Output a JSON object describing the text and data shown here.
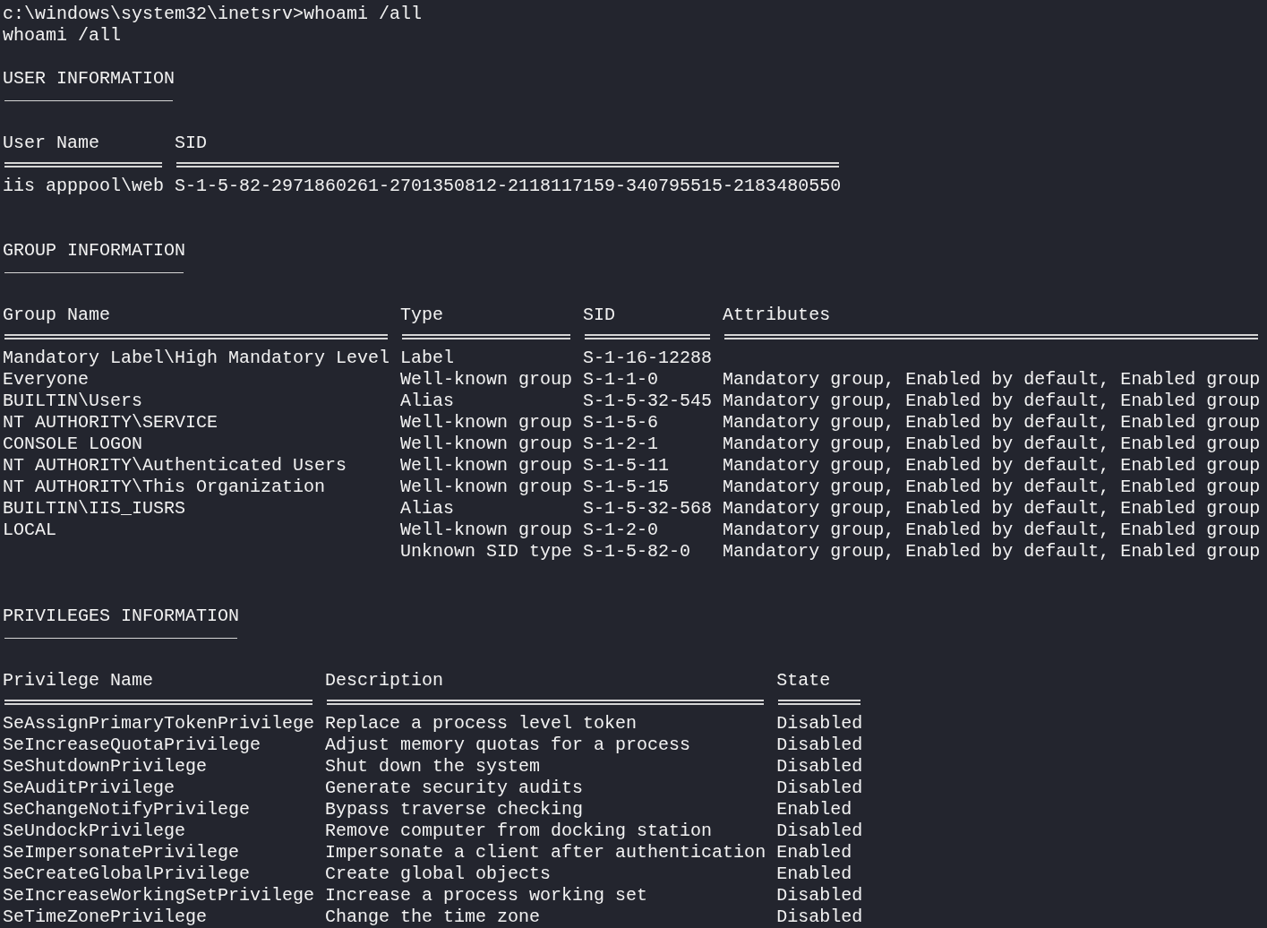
{
  "terminal": {
    "prompt_line": "c:\\windows\\system32\\inetsrv>whoami /all",
    "echo_line": "whoami /all"
  },
  "user_information": {
    "heading": "USER INFORMATION",
    "columns": [
      "User Name",
      "SID"
    ],
    "rows": [
      {
        "user_name": "iis apppool\\web",
        "sid": "S-1-5-82-2971860261-2701350812-2118117159-340795515-2183480550"
      }
    ]
  },
  "group_information": {
    "heading": "GROUP INFORMATION",
    "columns": [
      "Group Name",
      "Type",
      "SID",
      "Attributes"
    ],
    "rows": [
      {
        "group_name": "Mandatory Label\\High Mandatory Level",
        "type": "Label",
        "sid": "S-1-16-12288"
      },
      {
        "group_name": "Everyone",
        "type": "Well-known group",
        "sid": "S-1-1-0",
        "attributes": "Mandatory group, Enabled by default, Enabled group"
      },
      {
        "group_name": "BUILTIN\\Users",
        "type": "Alias",
        "sid": "S-1-5-32-545",
        "attributes": "Mandatory group, Enabled by default, Enabled group"
      },
      {
        "group_name": "NT AUTHORITY\\SERVICE",
        "type": "Well-known group",
        "sid": "S-1-5-6",
        "attributes": "Mandatory group, Enabled by default, Enabled group"
      },
      {
        "group_name": "CONSOLE LOGON",
        "type": "Well-known group",
        "sid": "S-1-2-1",
        "attributes": "Mandatory group, Enabled by default, Enabled group"
      },
      {
        "group_name": "NT AUTHORITY\\Authenticated Users",
        "type": "Well-known group",
        "sid": "S-1-5-11",
        "attributes": "Mandatory group, Enabled by default, Enabled group"
      },
      {
        "group_name": "NT AUTHORITY\\This Organization",
        "type": "Well-known group",
        "sid": "S-1-5-15",
        "attributes": "Mandatory group, Enabled by default, Enabled group"
      },
      {
        "group_name": "BUILTIN\\IIS_IUSRS",
        "type": "Alias",
        "sid": "S-1-5-32-568",
        "attributes": "Mandatory group, Enabled by default, Enabled group"
      },
      {
        "group_name": "LOCAL",
        "type": "Well-known group",
        "sid": "S-1-2-0",
        "attributes": "Mandatory group, Enabled by default, Enabled group"
      },
      {
        "type": "Unknown SID type",
        "sid": "S-1-5-82-0",
        "attributes": "Mandatory group, Enabled by default, Enabled group"
      }
    ]
  },
  "privileges_information": {
    "heading": "PRIVILEGES INFORMATION",
    "columns": [
      "Privilege Name",
      "Description",
      "State"
    ],
    "rows": [
      {
        "privilege_name": "SeAssignPrimaryTokenPrivilege",
        "description": "Replace a process level token",
        "state": "Disabled"
      },
      {
        "privilege_name": "SeIncreaseQuotaPrivilege",
        "description": "Adjust memory quotas for a process",
        "state": "Disabled"
      },
      {
        "privilege_name": "SeShutdownPrivilege",
        "description": "Shut down the system",
        "state": "Disabled"
      },
      {
        "privilege_name": "SeAuditPrivilege",
        "description": "Generate security audits",
        "state": "Disabled"
      },
      {
        "privilege_name": "SeChangeNotifyPrivilege",
        "description": "Bypass traverse checking",
        "state": "Enabled"
      },
      {
        "privilege_name": "SeUndockPrivilege",
        "description": "Remove computer from docking station",
        "state": "Disabled"
      },
      {
        "privilege_name": "SeImpersonatePrivilege",
        "description": "Impersonate a client after authentication",
        "state": "Enabled"
      },
      {
        "privilege_name": "SeCreateGlobalPrivilege",
        "description": "Create global objects",
        "state": "Enabled"
      },
      {
        "privilege_name": "SeIncreaseWorkingSetPrivilege",
        "description": "Increase a process working set",
        "state": "Disabled"
      },
      {
        "privilege_name": "SeTimeZonePrivilege",
        "description": "Change the time zone",
        "state": "Disabled"
      }
    ]
  }
}
